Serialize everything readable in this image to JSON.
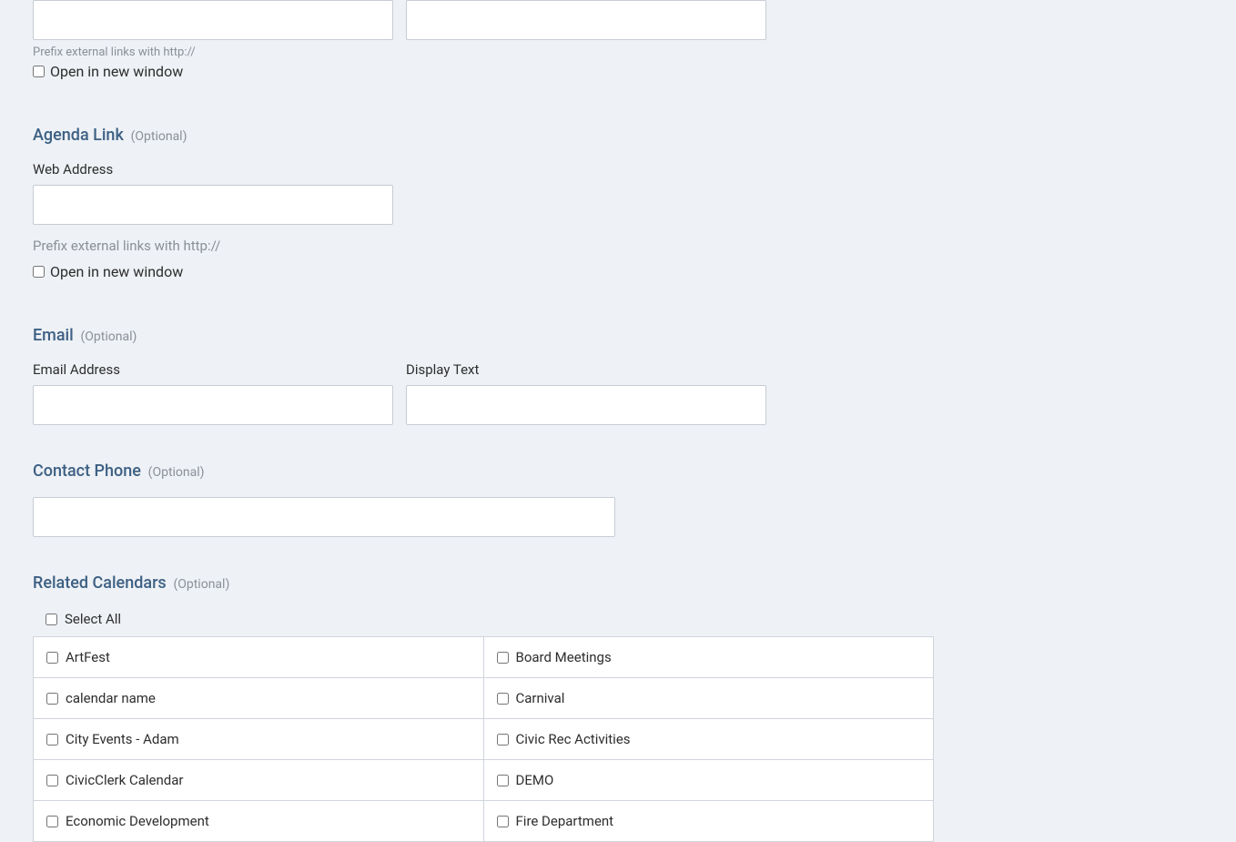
{
  "top_link": {
    "prefix_helper": "Prefix external links with http://",
    "open_new_window_label": "Open in new window"
  },
  "agenda_link": {
    "title": "Agenda Link",
    "optional": "(Optional)",
    "web_address_label": "Web Address",
    "prefix_helper": "Prefix external links with http://",
    "open_new_window_label": "Open in new window"
  },
  "email": {
    "title": "Email",
    "optional": "(Optional)",
    "email_address_label": "Email Address",
    "display_text_label": "Display Text"
  },
  "contact_phone": {
    "title": "Contact Phone",
    "optional": "(Optional)"
  },
  "related_calendars": {
    "title": "Related Calendars",
    "optional": "(Optional)",
    "select_all_label": "Select All",
    "items": [
      [
        "ArtFest",
        "Board Meetings"
      ],
      [
        "calendar name",
        "Carnival"
      ],
      [
        "City Events - Adam",
        "Civic Rec Activities"
      ],
      [
        "CivicClerk Calendar",
        "DEMO"
      ],
      [
        "Economic Development",
        "Fire Department"
      ]
    ]
  }
}
